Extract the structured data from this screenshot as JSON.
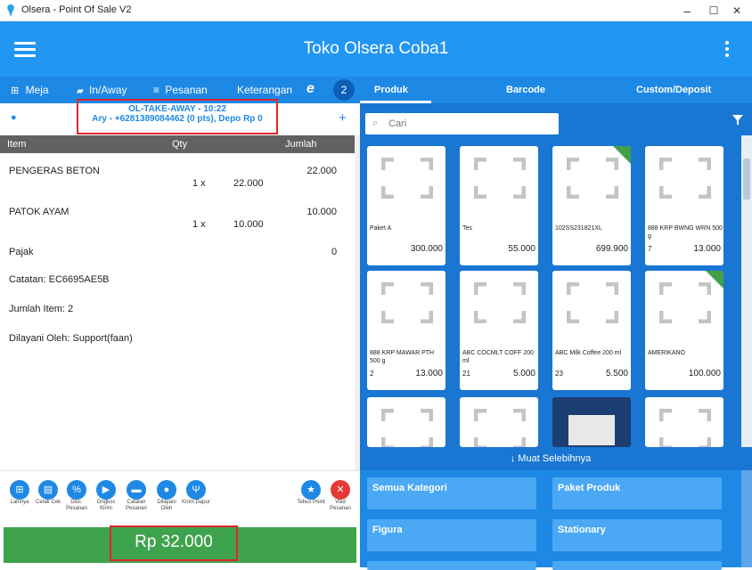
{
  "window": {
    "title": "Olsera - Point Of Sale V2",
    "min": "–",
    "max": "☐",
    "close": "✕"
  },
  "header": {
    "store_name": "Toko Olsera Coba1"
  },
  "toolbar": {
    "meja": "Meja",
    "in_away": "In/Away",
    "pesanan": "Pesanan",
    "keterangan": "Keterangan",
    "badge": "2"
  },
  "tabs": [
    "Produk",
    "Barcode",
    "Custom/Deposit"
  ],
  "customer": {
    "line1": "OL-TAKE-AWAY - 10:22",
    "line2": "Ary - +6281389084462 (0 pts), Depo Rp 0"
  },
  "table_header": {
    "item": "Item",
    "qty": "Qty",
    "jumlah": "Jumlah"
  },
  "order_items": [
    {
      "name": "PENGERAS BETON",
      "qty": "1 x",
      "price": "22.000",
      "total": "22.000"
    },
    {
      "name": "PATOK AYAM",
      "qty": "1 x",
      "price": "10.000",
      "total": "10.000"
    }
  ],
  "summary": {
    "pajak_label": "Pajak",
    "pajak_value": "0",
    "catatan": "Catatan: EC6695AE5B",
    "jumlah_item": "Jumlah Item: 2",
    "dilayani": "Dilayani Oleh: Support(faan)"
  },
  "actions": [
    {
      "icon": "grid-icon",
      "label": "Lainnya"
    },
    {
      "icon": "print-icon",
      "label": "Cetak Cek"
    },
    {
      "icon": "discount-icon",
      "label": "Disc. Pesanan"
    },
    {
      "icon": "truck-icon",
      "label": "Ongkos Kirim"
    },
    {
      "icon": "chat-icon",
      "label": "Catatan Pesanan"
    },
    {
      "icon": "person-icon",
      "label": "Dilayani Oleh"
    },
    {
      "icon": "kitchen-icon",
      "label": "Kirim Dapur"
    },
    {
      "icon": "star-icon",
      "label": "Tebus Point"
    },
    {
      "icon": "close-icon",
      "label": "Void Pesanan"
    }
  ],
  "total": "Rp 32.000",
  "search": {
    "placeholder": "Cari"
  },
  "products": [
    {
      "name": "Paket A",
      "stock": "",
      "price": "300.000",
      "tag": false
    },
    {
      "name": "Tes",
      "stock": "",
      "price": "55.000",
      "tag": false
    },
    {
      "name": "102SS231821XL",
      "stock": "",
      "price": "699.900",
      "tag": true
    },
    {
      "name": "888 KRP BWNG WRN 500 g",
      "stock": "7",
      "price": "13.000",
      "tag": false
    },
    {
      "name": "888 KRP MAWAR PTH 500 g",
      "stock": "2",
      "price": "13.000",
      "tag": false
    },
    {
      "name": "ABC COCMLT COFF 200 ml",
      "stock": "21",
      "price": "5.000",
      "tag": false
    },
    {
      "name": "ABC Milk Coffee 200 ml",
      "stock": "23",
      "price": "5.500",
      "tag": false
    },
    {
      "name": "AMERIKANO",
      "stock": "",
      "price": "100.000",
      "tag": true
    }
  ],
  "load_more": "Muat Selebihnya",
  "categories": [
    "Semua Kategori",
    "Paket Produk",
    "Figura",
    "Stationary"
  ],
  "colors": {
    "primary": "#2196F3",
    "dark": "#1976D2",
    "pay": "#3fa34d",
    "void": "#e53935",
    "highlight": "#e0262b"
  }
}
